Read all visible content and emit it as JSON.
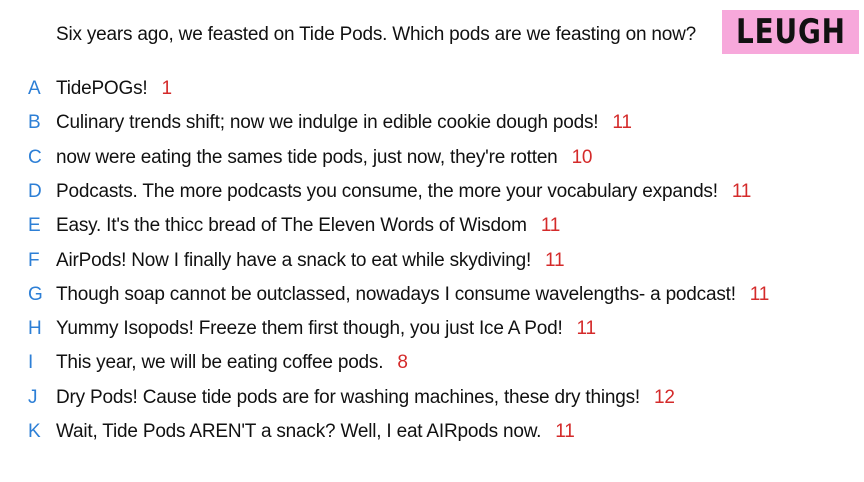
{
  "prompt": "Six years ago, we feasted on Tide Pods. Which pods are we feasting on now?",
  "logo": "LEUGH",
  "colors": {
    "letter": "#2d7fd6",
    "score": "#d42a2a",
    "logo_bg": "#f7a8db"
  },
  "answers": [
    {
      "letter": "A",
      "text": "TidePOGs!",
      "score": "1"
    },
    {
      "letter": "B",
      "text": "Culinary trends shift; now we indulge in edible cookie dough pods!",
      "score": "11"
    },
    {
      "letter": "C",
      "text": "now were eating the sames tide pods, just now, they're rotten",
      "score": "10"
    },
    {
      "letter": "D",
      "text": "Podcasts. The more podcasts you consume, the more your vocabulary expands!",
      "score": "11"
    },
    {
      "letter": "E",
      "text": "Easy. It's the thicc bread of The Eleven Words of Wisdom",
      "score": "11"
    },
    {
      "letter": "F",
      "text": "AirPods! Now I finally have a snack to eat while skydiving!",
      "score": "11"
    },
    {
      "letter": "G",
      "text": "Though soap cannot be outclassed, nowadays I consume wavelengths- a podcast!",
      "score": "11"
    },
    {
      "letter": "H",
      "text": "Yummy Isopods! Freeze them first though, you just Ice A Pod!",
      "score": "11"
    },
    {
      "letter": "I",
      "text": "This year, we will be eating coffee pods.",
      "score": "8"
    },
    {
      "letter": "J",
      "text": "Dry Pods! Cause tide pods are for washing machines, these dry things!",
      "score": "12"
    },
    {
      "letter": "K",
      "text": "Wait, Tide Pods AREN'T a snack? Well, I eat AIRpods now.",
      "score": "11"
    }
  ]
}
